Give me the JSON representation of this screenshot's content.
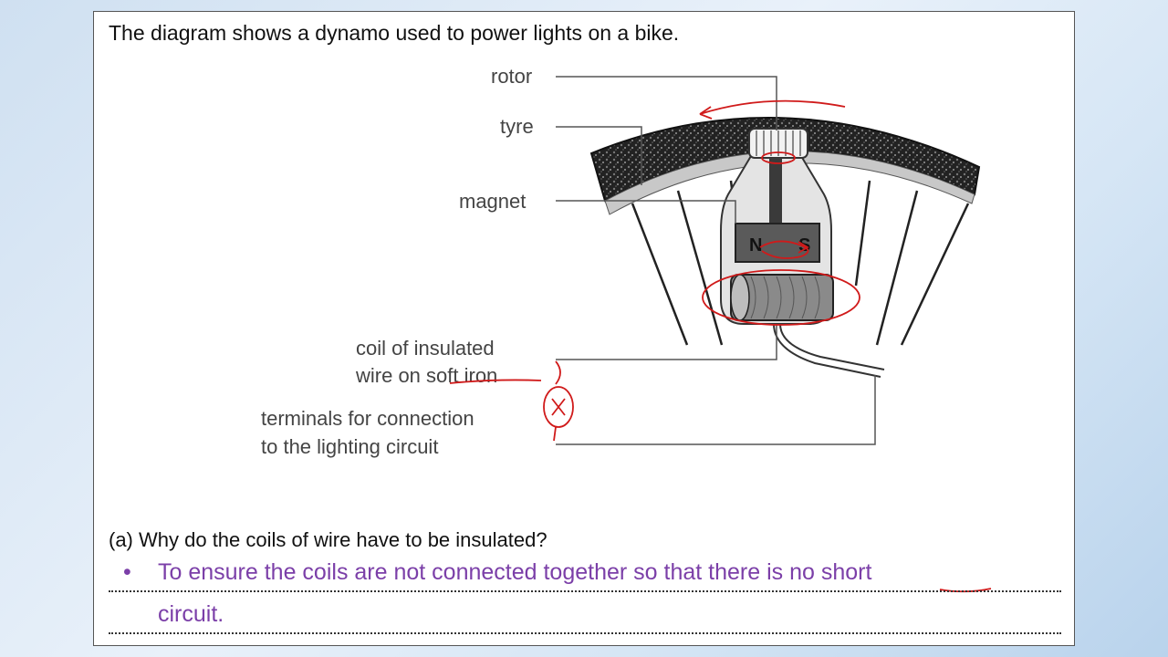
{
  "question": {
    "intro": "The diagram shows a dynamo used to power lights on a bike.",
    "part_a": "(a) Why do the coils of wire have to be insulated?"
  },
  "diagram": {
    "labels": {
      "rotor": "rotor",
      "tyre": "tyre",
      "magnet": "magnet",
      "coil_line1": "coil of insulated",
      "coil_line2": "wire on soft iron",
      "terminals_line1": "terminals for connection",
      "terminals_line2": "to the lighting circuit",
      "north": "N",
      "south": "S"
    },
    "annotation_mark": "X"
  },
  "answer": {
    "bullet": "•",
    "line1_before": "To ensure the coils are not connected together so that there is no ",
    "line1_underlined": "short",
    "line2": "circuit."
  },
  "colors": {
    "annotation_red": "#d01a1a",
    "answer_purple": "#7b3fa8"
  }
}
